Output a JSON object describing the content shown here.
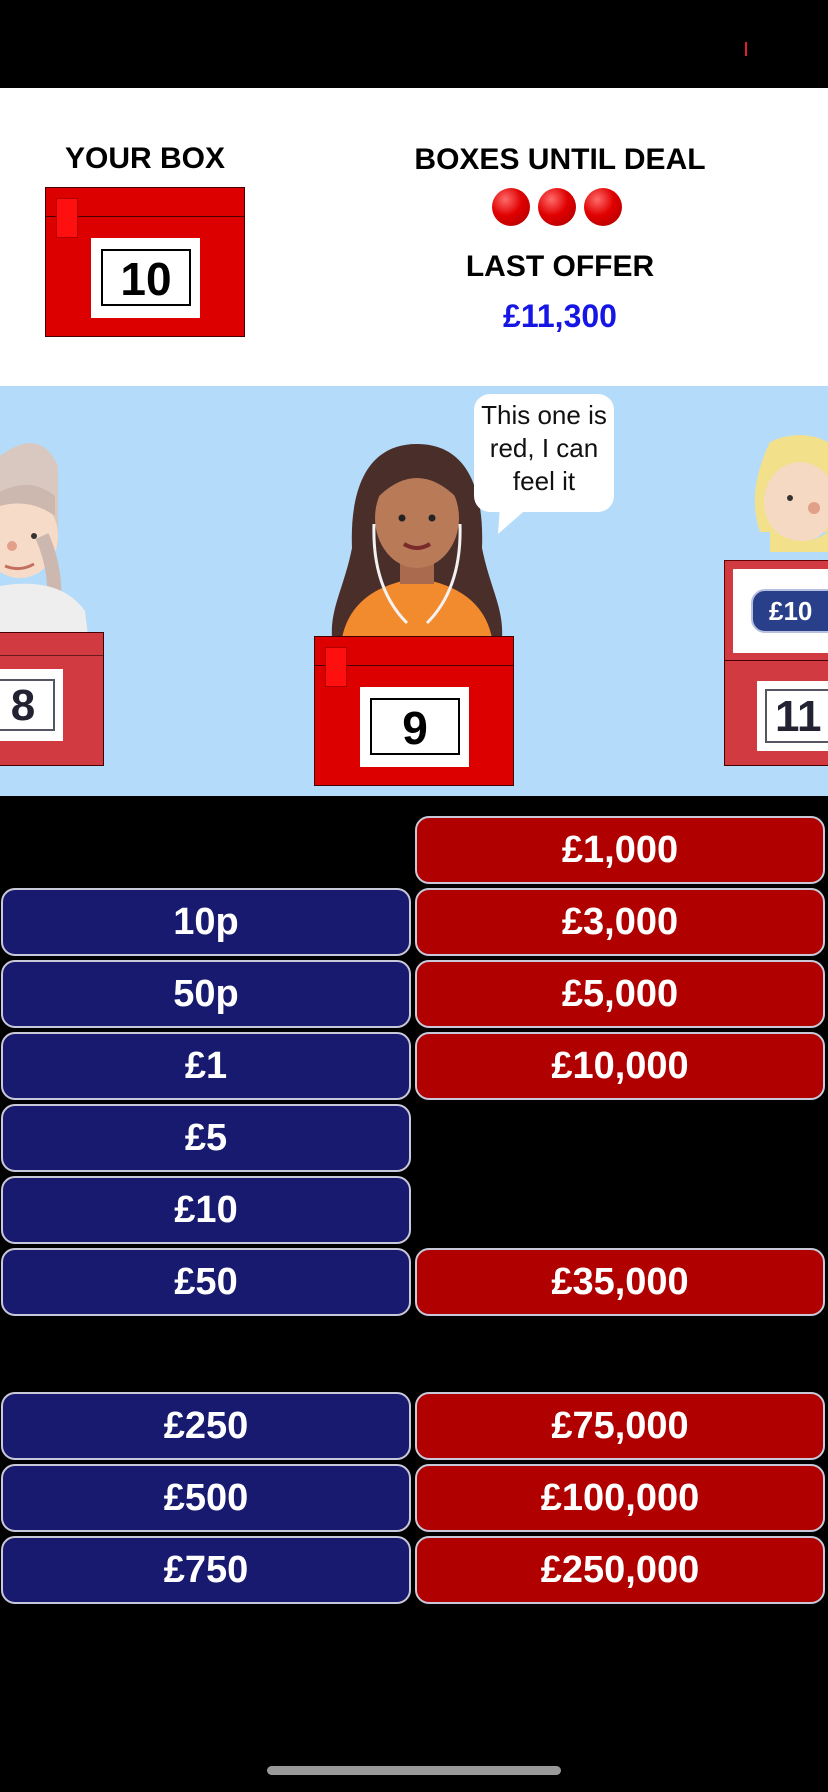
{
  "header": {
    "your_box_label": "YOUR BOX",
    "your_box_number": "10",
    "boxes_until_deal_label": "BOXES UNTIL DEAL",
    "boxes_until_deal_count": 3,
    "last_offer_label": "LAST OFFER",
    "last_offer_value": "£11,300"
  },
  "stage": {
    "left_box_number": "8",
    "center_box_number": "9",
    "right_box_number": "11",
    "right_offer_label": "£10",
    "speech": "This one is red, I can feel it"
  },
  "board": {
    "blue": [
      "10p",
      "50p",
      "£1",
      "£5",
      "£10",
      "£50",
      "£250",
      "£500",
      "£750"
    ],
    "red": [
      "£1,000",
      "£3,000",
      "£5,000",
      "£10,000",
      "£35,000",
      "£75,000",
      "£100,000",
      "£250,000"
    ]
  },
  "colors": {
    "box_red": "#dd0000",
    "blue_value": "#171a6e",
    "red_value": "#b00000",
    "offer_blue": "#1515e6",
    "stage_sky": "#b4dcfa"
  }
}
